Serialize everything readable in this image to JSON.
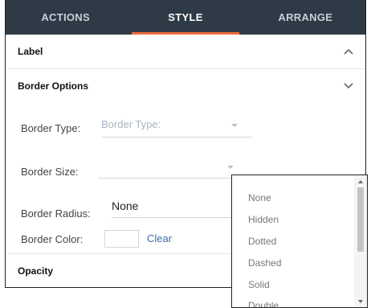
{
  "tabs": [
    {
      "label": "ACTIONS"
    },
    {
      "label": "STYLE"
    },
    {
      "label": "ARRANGE"
    }
  ],
  "sections": {
    "label": {
      "title": "Label"
    },
    "border": {
      "title": "Border Options"
    },
    "opacity": {
      "title": "Opacity"
    }
  },
  "border_options": {
    "type_label": "Border Type:",
    "type_placeholder": "Border Type:",
    "size_label": "Border Size:",
    "radius_label": "Border Radius:",
    "radius_value": "None",
    "color_label": "Border Color:",
    "clear_label": "Clear"
  },
  "dropdown": {
    "options": [
      "None",
      "Hidden",
      "Dotted",
      "Dashed",
      "Solid",
      "Double"
    ]
  },
  "colors": {
    "tab_bar": "#2e3a46",
    "accent": "#ef6c3e",
    "link": "#3b6fb0"
  }
}
